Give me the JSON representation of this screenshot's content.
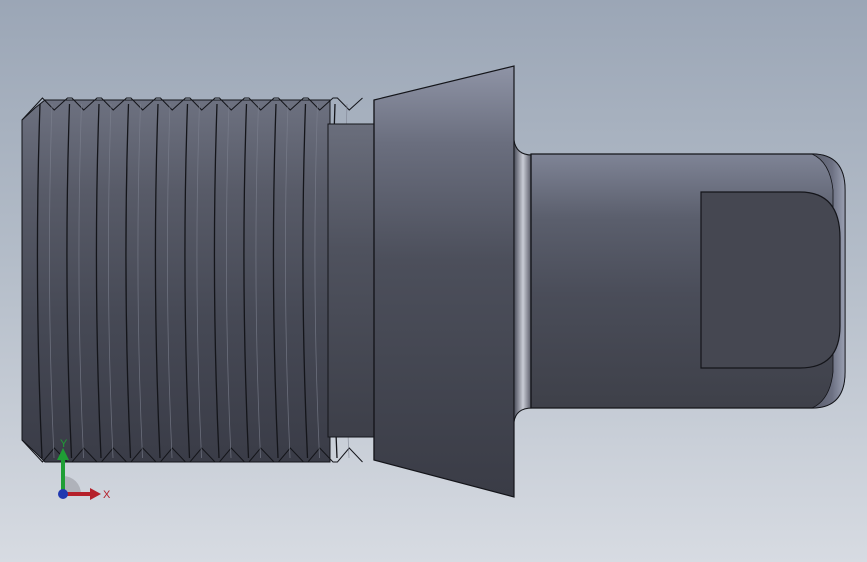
{
  "viewport": {
    "background_top": "#9ba6b6",
    "background_bottom": "#d7dbe2"
  },
  "model": {
    "part_type": "threaded-stud-with-conical-collar",
    "body_color": "#4a4d59",
    "edge_color": "#14151a"
  },
  "triad": {
    "x_label": "X",
    "y_label": "Y",
    "x_color": "#b5202a",
    "y_color": "#1f9e35",
    "z_color": "#2038b0"
  }
}
